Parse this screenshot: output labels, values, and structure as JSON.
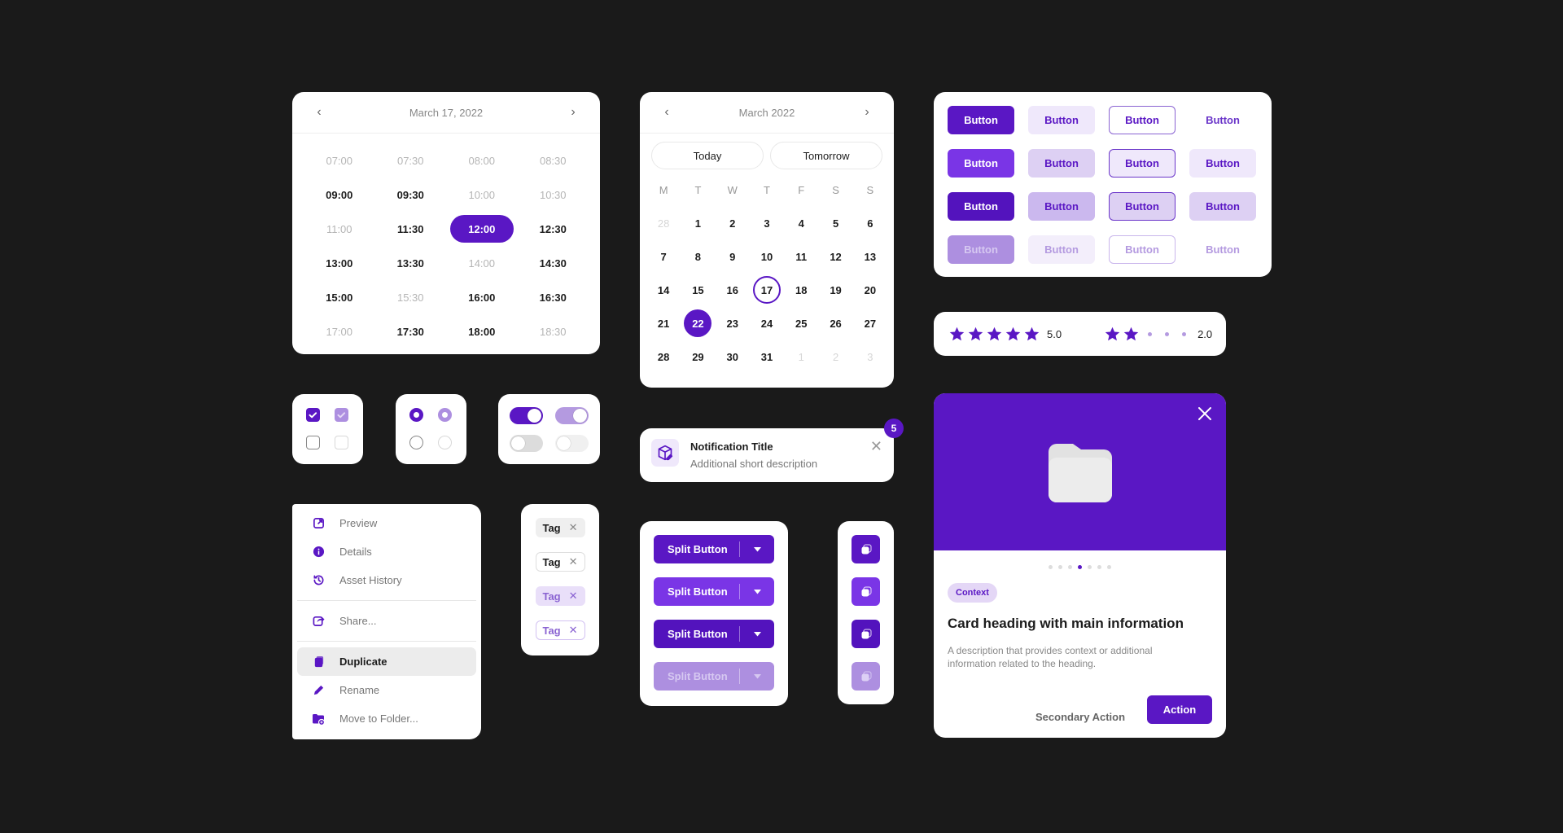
{
  "colors": {
    "background": "#1a1a1a",
    "primary": "#5a17c4",
    "primary_hover": "#7a35e6",
    "primary_disabled": "#ad8fe0",
    "tint": "#efe8fb",
    "tint_strong": "#e4d7f6"
  },
  "time_picker": {
    "title": "March 17, 2022",
    "prev_icon": "chevron-left-icon",
    "next_icon": "chevron-right-icon",
    "slots": [
      {
        "time": "07:00",
        "state": "disabled"
      },
      {
        "time": "07:30",
        "state": "disabled"
      },
      {
        "time": "08:00",
        "state": "disabled"
      },
      {
        "time": "08:30",
        "state": "disabled"
      },
      {
        "time": "09:00",
        "state": "available"
      },
      {
        "time": "09:30",
        "state": "available"
      },
      {
        "time": "10:00",
        "state": "disabled"
      },
      {
        "time": "10:30",
        "state": "disabled"
      },
      {
        "time": "11:00",
        "state": "disabled"
      },
      {
        "time": "11:30",
        "state": "available"
      },
      {
        "time": "12:00",
        "state": "selected"
      },
      {
        "time": "12:30",
        "state": "available"
      },
      {
        "time": "13:00",
        "state": "available"
      },
      {
        "time": "13:30",
        "state": "available"
      },
      {
        "time": "14:00",
        "state": "disabled"
      },
      {
        "time": "14:30",
        "state": "available"
      },
      {
        "time": "15:00",
        "state": "available"
      },
      {
        "time": "15:30",
        "state": "disabled"
      },
      {
        "time": "16:00",
        "state": "available"
      },
      {
        "time": "16:30",
        "state": "available"
      },
      {
        "time": "17:00",
        "state": "disabled"
      },
      {
        "time": "17:30",
        "state": "available"
      },
      {
        "time": "18:00",
        "state": "available"
      },
      {
        "time": "18:30",
        "state": "disabled"
      }
    ]
  },
  "date_picker": {
    "title": "March 2022",
    "quick": [
      "Today",
      "Tomorrow"
    ],
    "weekdays": [
      "M",
      "T",
      "W",
      "T",
      "F",
      "S",
      "S"
    ],
    "days": [
      {
        "d": "28",
        "s": "muted"
      },
      {
        "d": "1"
      },
      {
        "d": "2"
      },
      {
        "d": "3"
      },
      {
        "d": "4"
      },
      {
        "d": "5"
      },
      {
        "d": "6"
      },
      {
        "d": "7"
      },
      {
        "d": "8"
      },
      {
        "d": "9"
      },
      {
        "d": "10"
      },
      {
        "d": "11"
      },
      {
        "d": "12"
      },
      {
        "d": "13"
      },
      {
        "d": "14"
      },
      {
        "d": "15"
      },
      {
        "d": "16"
      },
      {
        "d": "17",
        "s": "today"
      },
      {
        "d": "18"
      },
      {
        "d": "19"
      },
      {
        "d": "20"
      },
      {
        "d": "21"
      },
      {
        "d": "22",
        "s": "sel"
      },
      {
        "d": "23"
      },
      {
        "d": "24"
      },
      {
        "d": "25"
      },
      {
        "d": "26"
      },
      {
        "d": "27"
      },
      {
        "d": "28"
      },
      {
        "d": "29"
      },
      {
        "d": "30"
      },
      {
        "d": "31"
      },
      {
        "d": "1",
        "s": "muted"
      },
      {
        "d": "2",
        "s": "muted"
      },
      {
        "d": "3",
        "s": "muted"
      }
    ]
  },
  "button_grid": {
    "label": "Button",
    "rows": [
      {
        "state": "default",
        "variants": [
          {
            "bg": "#5a17c4",
            "fg": "#ffffff",
            "border": "#5a17c4"
          },
          {
            "bg": "#efe8fb",
            "fg": "#5a17c4",
            "border": "#efe8fb"
          },
          {
            "bg": "#ffffff",
            "fg": "#5a17c4",
            "border": "#8a63d2"
          },
          {
            "bg": "#ffffff",
            "fg": "#6a35c9",
            "border": "#ffffff"
          }
        ]
      },
      {
        "state": "hover",
        "variants": [
          {
            "bg": "#7a35e6",
            "fg": "#ffffff",
            "border": "#7a35e6"
          },
          {
            "bg": "#ddd0f3",
            "fg": "#5a17c4",
            "border": "#ddd0f3"
          },
          {
            "bg": "#efe8fb",
            "fg": "#5a17c4",
            "border": "#6a35c9"
          },
          {
            "bg": "#efe8fb",
            "fg": "#5a17c4",
            "border": "#efe8fb"
          }
        ]
      },
      {
        "state": "pressed",
        "variants": [
          {
            "bg": "#5313bd",
            "fg": "#ffffff",
            "border": "#5313bd"
          },
          {
            "bg": "#cbb8ee",
            "fg": "#5a17c4",
            "border": "#cbb8ee"
          },
          {
            "bg": "#ddd0f3",
            "fg": "#5a17c4",
            "border": "#6a35c9"
          },
          {
            "bg": "#ddd0f3",
            "fg": "#5a17c4",
            "border": "#ddd0f3"
          }
        ]
      },
      {
        "state": "disabled",
        "variants": [
          {
            "bg": "#ad8fe0",
            "fg": "#d6c8f1",
            "border": "#ad8fe0"
          },
          {
            "bg": "#f3eefb",
            "fg": "#b49ae0",
            "border": "#f3eefb"
          },
          {
            "bg": "#ffffff",
            "fg": "#b49ae0",
            "border": "#c9b6ec"
          },
          {
            "bg": "#ffffff",
            "fg": "#b49ae0",
            "border": "#ffffff"
          }
        ]
      }
    ]
  },
  "ratings": [
    {
      "value": "5.0",
      "filled": 5,
      "max": 5
    },
    {
      "value": "2.0",
      "filled": 2,
      "max": 5
    }
  ],
  "checkboxes": [
    {
      "checked": true,
      "disabled": false
    },
    {
      "checked": true,
      "disabled": true
    },
    {
      "checked": false,
      "disabled": false
    },
    {
      "checked": false,
      "disabled": true
    }
  ],
  "radios": [
    {
      "checked": true,
      "disabled": false
    },
    {
      "checked": true,
      "disabled": true
    },
    {
      "checked": false,
      "disabled": false
    },
    {
      "checked": false,
      "disabled": true
    }
  ],
  "toggles": [
    {
      "on": true,
      "disabled": false
    },
    {
      "on": true,
      "disabled": true
    },
    {
      "on": false,
      "disabled": false
    },
    {
      "on": false,
      "disabled": true
    }
  ],
  "notification": {
    "icon": "package-edit-icon",
    "title": "Notification Title",
    "description": "Additional short description",
    "badge": "5",
    "close_icon": "close-icon"
  },
  "context_menu": {
    "groups": [
      [
        {
          "label": "Preview",
          "icon": "external-link-icon"
        },
        {
          "label": "Details",
          "icon": "info-icon"
        },
        {
          "label": "Asset History",
          "icon": "history-icon"
        }
      ],
      [
        {
          "label": "Share...",
          "icon": "share-icon"
        }
      ],
      [
        {
          "label": "Duplicate",
          "icon": "duplicate-icon",
          "active": true
        },
        {
          "label": "Rename",
          "icon": "pencil-icon"
        },
        {
          "label": "Move to Folder...",
          "icon": "folder-move-icon"
        }
      ]
    ]
  },
  "tags": [
    {
      "label": "Tag",
      "variant": "filled-neutral"
    },
    {
      "label": "Tag",
      "variant": "outline-neutral"
    },
    {
      "label": "Tag",
      "variant": "filled-accent"
    },
    {
      "label": "Tag",
      "variant": "outline-accent"
    }
  ],
  "split_buttons": {
    "label": "Split Button",
    "states": [
      {
        "state": "default",
        "bg": "#5a17c4",
        "fg": "#ffffff"
      },
      {
        "state": "hover",
        "bg": "#7a35e6",
        "fg": "#ffffff"
      },
      {
        "state": "pressed",
        "bg": "#5313bd",
        "fg": "#ffffff"
      },
      {
        "state": "disabled",
        "bg": "#ad8fe0",
        "fg": "#d6c8f1"
      }
    ]
  },
  "icon_buttons": {
    "icon": "copy-icon",
    "states": [
      {
        "state": "default",
        "bg": "#5a17c4"
      },
      {
        "state": "hover",
        "bg": "#7a35e6"
      },
      {
        "state": "pressed",
        "bg": "#5313bd"
      },
      {
        "state": "disabled",
        "bg": "#ad8fe0"
      }
    ]
  },
  "feature_card": {
    "hero_icon": "folder-icon",
    "close_icon": "close-icon",
    "pager": {
      "count": 7,
      "active": 4
    },
    "context": "Context",
    "heading": "Card heading with main information",
    "description": "A description that provides context or additional information related to the heading.",
    "secondary_action": "Secondary Action",
    "primary_action": "Action"
  }
}
